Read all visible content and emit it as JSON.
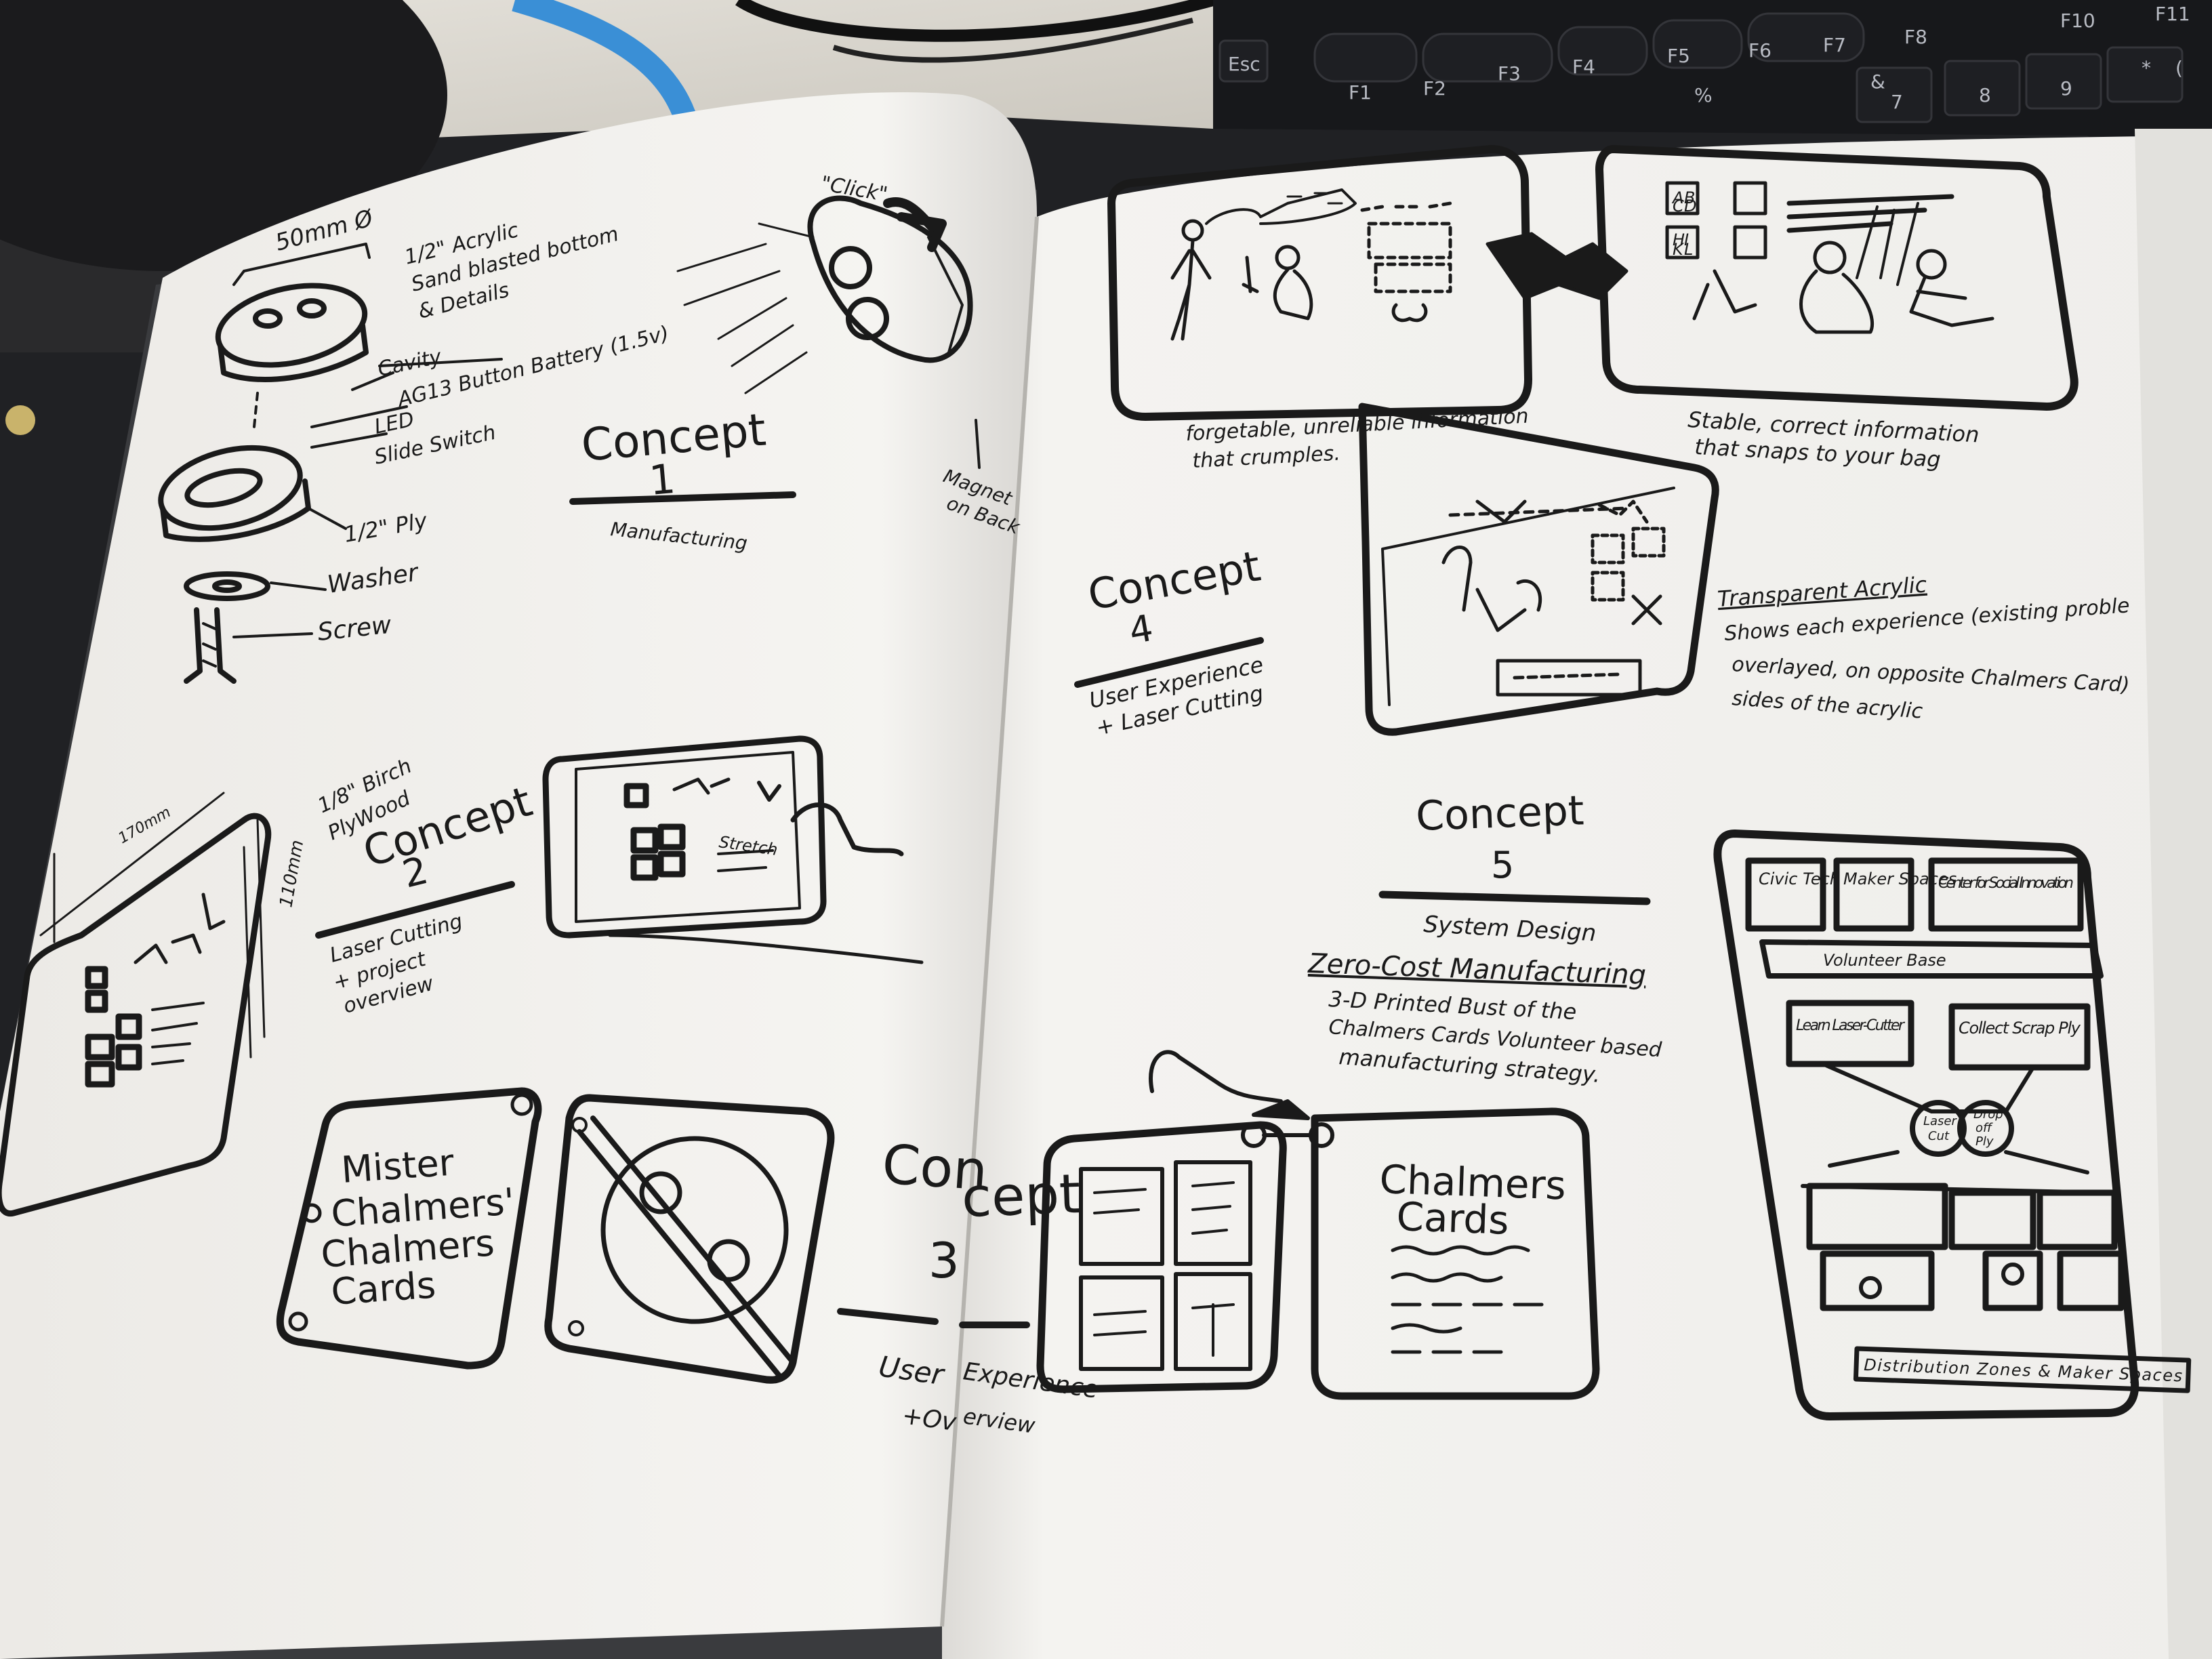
{
  "photo": {
    "subject": "",
    "colors": {
      "desk": "#d9d6cf",
      "paper": "#f2f1ee",
      "ink": "#1a1a1a",
      "keyboard": "#17181b",
      "cable": "#3a8fd6"
    }
  },
  "keyboard": {
    "keys": [
      "Esc",
      "F1",
      "F2",
      "F3",
      "F4",
      "F5",
      "F6",
      "F7",
      "F8",
      "F10",
      "F11",
      "%",
      "&",
      "*",
      "(",
      "7",
      "8",
      "9"
    ]
  },
  "left_page": {
    "concept1": {
      "title": "Concept",
      "number": "1",
      "subtitle": "Manufacturing",
      "dimension": "50mm Ø",
      "click_label": "\"Click\"",
      "labels": [
        "1/2\" Acrylic",
        "Sand blasted bottom",
        "& Details",
        "Cavity",
        "AG13 Button Battery (1.5v)",
        "LED",
        "Slide Switch",
        "1/2\" Ply",
        "Washer",
        "Screw"
      ],
      "magnet_note": [
        "Magnet",
        "on Back"
      ]
    },
    "concept2": {
      "title": "Concept",
      "number": "2",
      "subtitle": [
        "Laser Cutting",
        "+ project",
        "overview"
      ],
      "material": [
        "1/8\" Birch",
        "PlyWood"
      ],
      "width": "170mm",
      "height": "110mm",
      "sketch_word": "Stretch"
    },
    "concept3": {
      "title_part1": "Con",
      "title_part2": "cept",
      "number": "3",
      "subtitle_part1": [
        "User",
        "+Ov"
      ],
      "subtitle_part2": [
        "Experience",
        "erview"
      ],
      "card_front": [
        "Mister",
        "Chalmers'",
        "Chalmers",
        "Cards"
      ],
      "card_back": [
        "Chalmers",
        "Cards"
      ]
    }
  },
  "right_page": {
    "concept4": {
      "title": "Concept",
      "number": "4",
      "subtitle": [
        "User Experience",
        "+ Laser Cutting"
      ],
      "caption_left": [
        "forgetable, unreliable information",
        "that crumples."
      ],
      "caption_right": [
        "Stable, correct information",
        "that snaps to your bag"
      ],
      "panel_labels": [
        "A",
        "B",
        "C",
        "D",
        "H",
        "I",
        "K",
        "L"
      ],
      "note_title": "Transparent Acrylic",
      "note_lines": [
        "Shows each experience (existing proble",
        "overlayed, on opposite     Chalmers Card)",
        "sides of the acrylic"
      ]
    },
    "concept5": {
      "title": "Concept",
      "number": "5",
      "subtitle": "System Design",
      "heading": "Zero-Cost Manufacturing",
      "body": [
        "3-D Printed Bust of the",
        "Chalmers Cards Volunteer based",
        "manufacturing strategy."
      ],
      "diagram": {
        "top_boxes": [
          "Civic Tech",
          "Maker Spaces",
          "Center for Social Innovation"
        ],
        "band": "Volunteer Base",
        "middle_boxes": [
          "Learn Laser-Cutter",
          "Collect Scrap Ply"
        ],
        "circle_left": [
          "Laser",
          "Cut"
        ],
        "circle_right": [
          "Drop",
          "off",
          "Ply"
        ],
        "footer": "Distribution Zones & Maker Spaces"
      }
    }
  }
}
